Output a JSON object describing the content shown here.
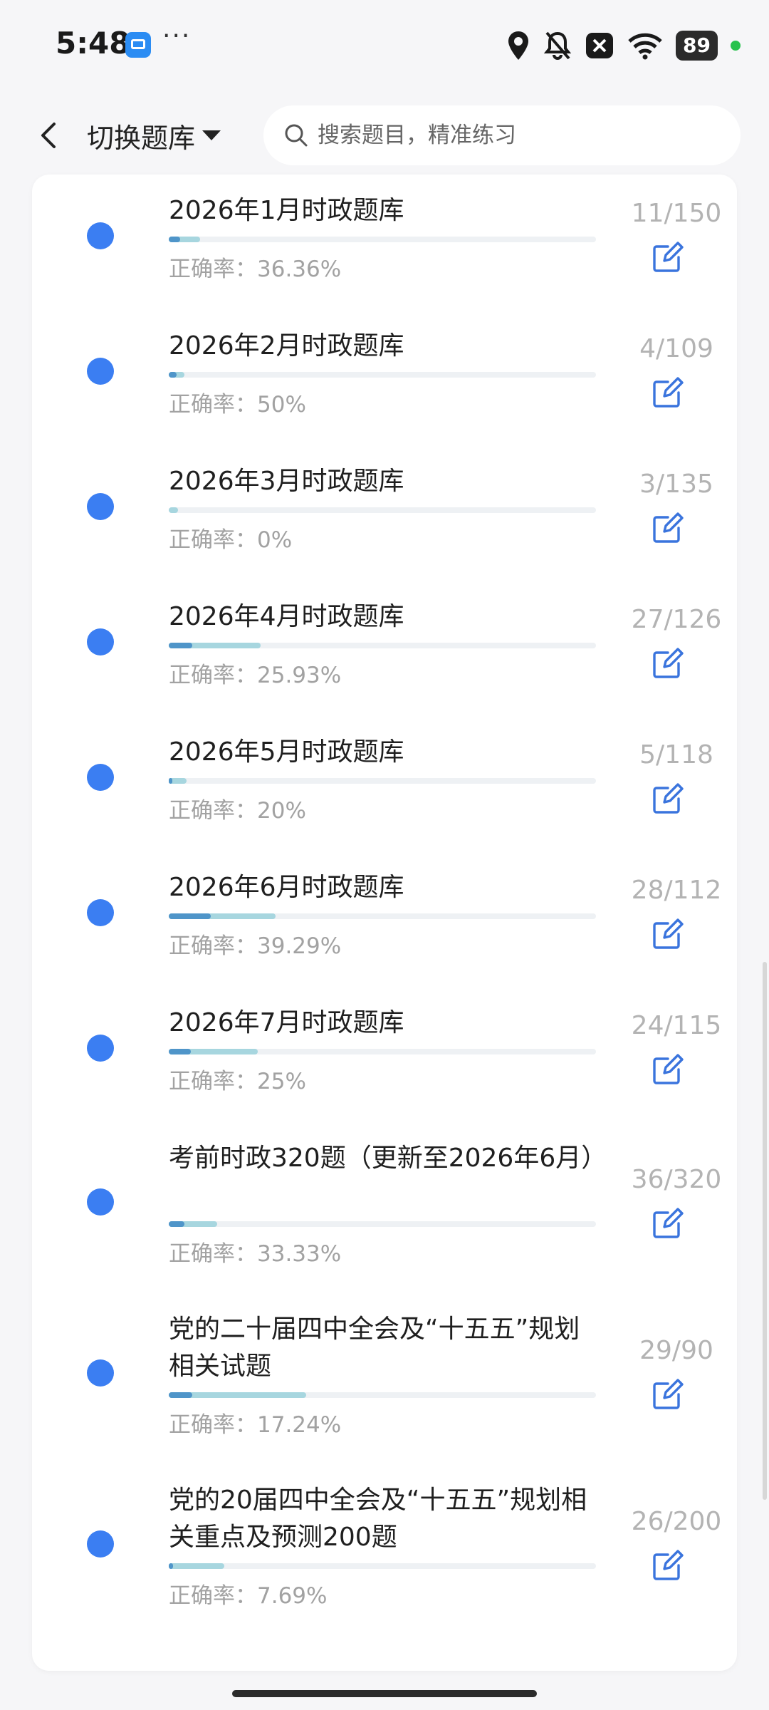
{
  "status_bar": {
    "time": "5:48",
    "more": "···",
    "battery": "89"
  },
  "header": {
    "switch_label": "切换题库",
    "search_placeholder": "搜索题目，精准练习"
  },
  "accuracy_prefix": "正确率：",
  "colors": {
    "accent": "#3b7ef2",
    "progress_light": "#a7d6df",
    "progress_dark": "#4f95c9"
  },
  "items": [
    {
      "title": "2026年1月时政题库",
      "count": "11/150",
      "accuracy": "36.36%",
      "progress": 0.0733,
      "accuracy_value": 0.3636
    },
    {
      "title": "2026年2月时政题库",
      "count": "4/109",
      "accuracy": "50%",
      "progress": 0.0367,
      "accuracy_value": 0.5
    },
    {
      "title": "2026年3月时政题库",
      "count": "3/135",
      "accuracy": "0%",
      "progress": 0.0222,
      "accuracy_value": 0.0
    },
    {
      "title": "2026年4月时政题库",
      "count": "27/126",
      "accuracy": "25.93%",
      "progress": 0.2143,
      "accuracy_value": 0.2593
    },
    {
      "title": "2026年5月时政题库",
      "count": "5/118",
      "accuracy": "20%",
      "progress": 0.0424,
      "accuracy_value": 0.2
    },
    {
      "title": "2026年6月时政题库",
      "count": "28/112",
      "accuracy": "39.29%",
      "progress": 0.25,
      "accuracy_value": 0.3929
    },
    {
      "title": "2026年7月时政题库",
      "count": "24/115",
      "accuracy": "25%",
      "progress": 0.2087,
      "accuracy_value": 0.25
    },
    {
      "title": "考前时政320题（更新至2026年6月）",
      "count": "36/320",
      "accuracy": "33.33%",
      "progress": 0.1125,
      "accuracy_value": 0.3333
    },
    {
      "title": "党的二十届四中全会及“十五五”规划相关试题",
      "count": "29/90",
      "accuracy": "17.24%",
      "progress": 0.3222,
      "accuracy_value": 0.1724
    },
    {
      "title": "党的20届四中全会及“十五五”规划相关重点及预测200题",
      "count": "26/200",
      "accuracy": "7.69%",
      "progress": 0.13,
      "accuracy_value": 0.0769
    }
  ]
}
